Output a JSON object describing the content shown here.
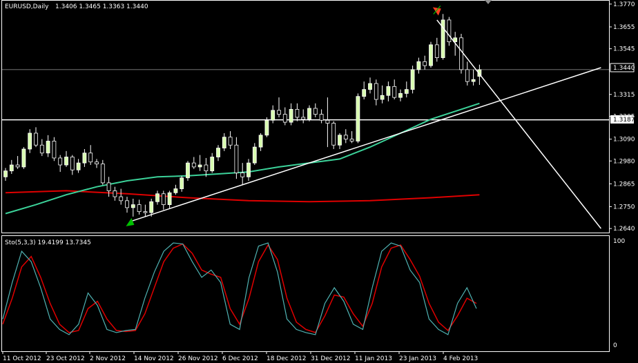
{
  "header": {
    "symbol_label": "EURUSD,Daily",
    "ohlc_label": "1.3406 1.3465 1.3363 1.3440"
  },
  "indicator": {
    "label": "Sto(5,3,3) 19.4199 13.7345"
  },
  "price_labels": {
    "current": "1.3440",
    "horizontal_line": "1.3187"
  },
  "colors": {
    "background": "#000000",
    "frame": "#ffffff",
    "candle_bull": "#d8ffb0",
    "candle_bear": "#ffffff",
    "ma_fast": "#3cd39a",
    "ma_slow": "#e00000",
    "trendline": "#ffffff",
    "stoch_main": "#4fb3b3",
    "stoch_signal": "#e00000",
    "arrow_low": "#00c000",
    "arrow_high": "#ff4020"
  },
  "chart_data": [
    {
      "type": "candlestick",
      "symbol": "EURUSD",
      "timeframe": "Daily",
      "y_ticks": [
        1.377,
        1.3655,
        1.3545,
        1.3315,
        1.3205,
        1.309,
        1.298,
        1.2865,
        1.275,
        1.264
      ],
      "y_tick_labels": [
        "1.3770",
        "1.3655",
        "1.3545",
        "",
        "1.3315",
        "1.3205",
        "1.3090",
        "1.2980",
        "1.2865",
        "1.2750",
        "1.2640"
      ],
      "ylim": [
        1.263,
        1.378
      ],
      "x_labels": [
        "11 Oct 2012",
        "23 Oct 2012",
        "2 Nov 2012",
        "14 Nov 2012",
        "26 Nov 2012",
        "6 Dec 2012",
        "18 Dec 2012",
        "31 Dec 2012",
        "11 Jan 2013",
        "23 Jan 2013",
        "4 Feb 2013"
      ],
      "horizontal_line": 1.3187,
      "current_price": 1.344,
      "candles": [
        [
          1.29,
          1.2945,
          1.288,
          1.293
        ],
        [
          1.293,
          1.2985,
          1.2915,
          1.296
        ],
        [
          1.296,
          1.3005,
          1.294,
          1.295
        ],
        [
          1.295,
          1.305,
          1.294,
          1.304
        ],
        [
          1.304,
          1.314,
          1.302,
          1.312
        ],
        [
          1.312,
          1.315,
          1.305,
          1.306
        ],
        [
          1.306,
          1.309,
          1.3005,
          1.302
        ],
        [
          1.302,
          1.311,
          1.3,
          1.308
        ],
        [
          1.308,
          1.31,
          1.298,
          1.2995
        ],
        [
          1.2995,
          1.301,
          1.2925,
          1.296
        ],
        [
          1.296,
          1.303,
          1.295,
          1.3
        ],
        [
          1.3,
          1.301,
          1.291,
          1.2935
        ],
        [
          1.2935,
          1.299,
          1.292,
          1.297
        ],
        [
          1.297,
          1.304,
          1.295,
          1.302
        ],
        [
          1.302,
          1.306,
          1.296,
          1.2975
        ],
        [
          1.2975,
          1.299,
          1.2945,
          1.2965
        ],
        [
          1.2965,
          1.2985,
          1.286,
          1.287
        ],
        [
          1.287,
          1.29,
          1.28,
          1.283
        ],
        [
          1.283,
          1.285,
          1.278,
          1.28
        ],
        [
          1.28,
          1.284,
          1.276,
          1.278
        ],
        [
          1.278,
          1.28,
          1.272,
          1.2745
        ],
        [
          1.2745,
          1.279,
          1.27,
          1.276
        ],
        [
          1.276,
          1.2785,
          1.271,
          1.2725
        ],
        [
          1.2725,
          1.276,
          1.27,
          1.272
        ],
        [
          1.272,
          1.279,
          1.27,
          1.2775
        ],
        [
          1.2775,
          1.283,
          1.276,
          1.2815
        ],
        [
          1.2815,
          1.283,
          1.2735,
          1.276
        ],
        [
          1.276,
          1.283,
          1.274,
          1.282
        ],
        [
          1.282,
          1.286,
          1.281,
          1.284
        ],
        [
          1.284,
          1.2905,
          1.2825,
          1.2895
        ],
        [
          1.2895,
          1.298,
          1.288,
          1.297
        ],
        [
          1.297,
          1.3,
          1.294,
          1.295
        ],
        [
          1.295,
          1.301,
          1.293,
          1.296
        ],
        [
          1.296,
          1.2995,
          1.29,
          1.293
        ],
        [
          1.293,
          1.302,
          1.292,
          1.3
        ],
        [
          1.3,
          1.306,
          1.298,
          1.3045
        ],
        [
          1.3045,
          1.312,
          1.303,
          1.31
        ],
        [
          1.31,
          1.313,
          1.304,
          1.306
        ],
        [
          1.306,
          1.31,
          1.289,
          1.292
        ],
        [
          1.292,
          1.297,
          1.286,
          1.29
        ],
        [
          1.29,
          1.299,
          1.288,
          1.297
        ],
        [
          1.297,
          1.307,
          1.296,
          1.305
        ],
        [
          1.305,
          1.312,
          1.303,
          1.311
        ],
        [
          1.311,
          1.32,
          1.31,
          1.3185
        ],
        [
          1.3185,
          1.326,
          1.317,
          1.3235
        ],
        [
          1.3235,
          1.33,
          1.32,
          1.3215
        ],
        [
          1.3215,
          1.325,
          1.316,
          1.3175
        ],
        [
          1.3175,
          1.327,
          1.316,
          1.324
        ],
        [
          1.324,
          1.327,
          1.318,
          1.32
        ],
        [
          1.32,
          1.324,
          1.317,
          1.319
        ],
        [
          1.319,
          1.326,
          1.318,
          1.3245
        ],
        [
          1.3245,
          1.327,
          1.32,
          1.3215
        ],
        [
          1.3215,
          1.324,
          1.317,
          1.3185
        ],
        [
          1.3185,
          1.33,
          1.305,
          1.317
        ],
        [
          1.317,
          1.318,
          1.304,
          1.306
        ],
        [
          1.306,
          1.312,
          1.304,
          1.311
        ],
        [
          1.311,
          1.314,
          1.307,
          1.309
        ],
        [
          1.309,
          1.313,
          1.307,
          1.308
        ],
        [
          1.308,
          1.332,
          1.307,
          1.3305
        ],
        [
          1.3305,
          1.338,
          1.329,
          1.334
        ],
        [
          1.334,
          1.34,
          1.332,
          1.337
        ],
        [
          1.337,
          1.339,
          1.326,
          1.329
        ],
        [
          1.329,
          1.336,
          1.327,
          1.331
        ],
        [
          1.331,
          1.338,
          1.328,
          1.3355
        ],
        [
          1.3355,
          1.339,
          1.329,
          1.33
        ],
        [
          1.33,
          1.334,
          1.328,
          1.332
        ],
        [
          1.332,
          1.338,
          1.33,
          1.334
        ],
        [
          1.334,
          1.346,
          1.332,
          1.344
        ],
        [
          1.344,
          1.35,
          1.342,
          1.348
        ],
        [
          1.348,
          1.351,
          1.344,
          1.346
        ],
        [
          1.346,
          1.358,
          1.345,
          1.3565
        ],
        [
          1.3565,
          1.36,
          1.348,
          1.35
        ],
        [
          1.35,
          1.372,
          1.349,
          1.369
        ],
        [
          1.369,
          1.3705,
          1.356,
          1.358
        ],
        [
          1.358,
          1.363,
          1.351,
          1.36
        ],
        [
          1.36,
          1.362,
          1.342,
          1.344
        ],
        [
          1.344,
          1.348,
          1.336,
          1.338
        ],
        [
          1.338,
          1.344,
          1.336,
          1.339
        ],
        [
          1.3406,
          1.3465,
          1.3363,
          1.344
        ]
      ],
      "ma_fast_points": [
        [
          0,
          1.2715
        ],
        [
          5,
          1.276
        ],
        [
          10,
          1.281
        ],
        [
          15,
          1.285
        ],
        [
          20,
          1.288
        ],
        [
          25,
          1.29
        ],
        [
          30,
          1.2905
        ],
        [
          35,
          1.2915
        ],
        [
          40,
          1.2925
        ],
        [
          45,
          1.295
        ],
        [
          50,
          1.297
        ],
        [
          55,
          1.299
        ],
        [
          60,
          1.305
        ],
        [
          65,
          1.312
        ],
        [
          70,
          1.319
        ],
        [
          75,
          1.324
        ],
        [
          78,
          1.327
        ]
      ],
      "ma_slow_points": [
        [
          0,
          1.282
        ],
        [
          10,
          1.283
        ],
        [
          20,
          1.2815
        ],
        [
          30,
          1.2795
        ],
        [
          40,
          1.278
        ],
        [
          50,
          1.2775
        ],
        [
          60,
          1.278
        ],
        [
          70,
          1.2795
        ],
        [
          78,
          1.281
        ]
      ],
      "trendlines": [
        {
          "from": [
            20.5,
            1.2675
          ],
          "to": [
            98,
            1.345
          ]
        },
        {
          "from": [
            71,
            1.369
          ],
          "to": [
            98,
            1.264
          ]
        }
      ],
      "arrows": [
        {
          "kind": "low",
          "bar": 20.5,
          "price": 1.2665
        },
        {
          "kind": "high",
          "bar": 71,
          "price": 1.374
        }
      ]
    },
    {
      "type": "line",
      "name": "Sto(5,3,3)",
      "y_tick_labels": [
        "100",
        "0"
      ],
      "ylim": [
        0,
        100
      ],
      "main": [
        25,
        60,
        90,
        80,
        55,
        25,
        15,
        10,
        20,
        50,
        38,
        15,
        12,
        14,
        15,
        45,
        70,
        90,
        98,
        97,
        80,
        65,
        72,
        60,
        20,
        15,
        65,
        95,
        98,
        70,
        25,
        15,
        12,
        10,
        40,
        55,
        42,
        20,
        15,
        55,
        90,
        98,
        95,
        72,
        60,
        25,
        15,
        10,
        40,
        55,
        35
      ],
      "signal": [
        20,
        45,
        75,
        85,
        65,
        40,
        20,
        12,
        14,
        35,
        42,
        25,
        14,
        13,
        14,
        30,
        55,
        80,
        93,
        97,
        88,
        72,
        68,
        65,
        35,
        20,
        45,
        80,
        96,
        82,
        45,
        22,
        15,
        12,
        28,
        48,
        46,
        30,
        18,
        40,
        75,
        93,
        96,
        82,
        66,
        40,
        22,
        14,
        28,
        45,
        40
      ]
    }
  ]
}
